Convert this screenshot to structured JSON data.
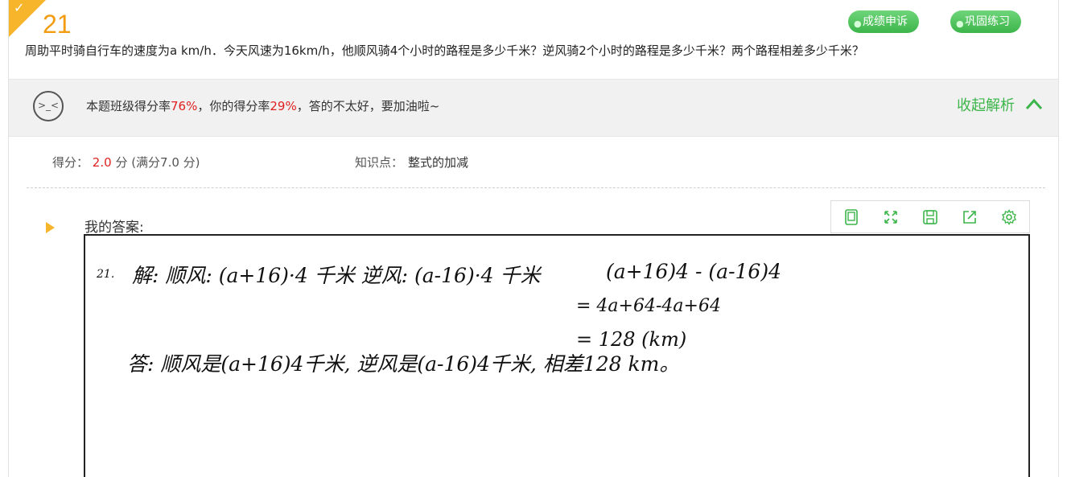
{
  "question": {
    "number": "21",
    "text": "周助平时骑自行车的速度为a km/h．今天风速为16km/h，他顺风骑4个小时的路程是多少千米？逆风骑2个小时的路程是多少千米？两个路程相差多少千米？",
    "badges": [
      "成绩申诉",
      "巩固练习"
    ]
  },
  "stats": {
    "prefix": "本题班级得分率",
    "class_rate": "76%",
    "middle": "，你的得分率",
    "your_rate": "29%",
    "suffix": "，答的不太好，要加油啦~",
    "face": ">_<",
    "collapse_label": "收起解析"
  },
  "score": {
    "label": "得分：",
    "value": "2.0",
    "rest": "分 (满分7.0 分)",
    "knowledge_label": "知识点：",
    "knowledge_value": "整式的加减"
  },
  "answer": {
    "label": "我的答案:",
    "tools": [
      "page-icon",
      "expand-icon",
      "save-icon",
      "share-icon",
      "settings-icon"
    ],
    "handwriting": {
      "qnum": "21.",
      "line1": "解: 顺风: (a+16)·4 千米  逆风: (a-16)·4 千米",
      "expr": "(a+16)4 - (a-16)4",
      "step1": "= 4a+64-4a+64",
      "step2": "= 128 (km)",
      "line2": "答: 顺风是(a+16)4千米, 逆风是(a-16)4千米, 相差128 km。"
    }
  },
  "colors": {
    "accent": "#3cb54a",
    "warn": "#e02020",
    "corner": "#f7b52c"
  }
}
